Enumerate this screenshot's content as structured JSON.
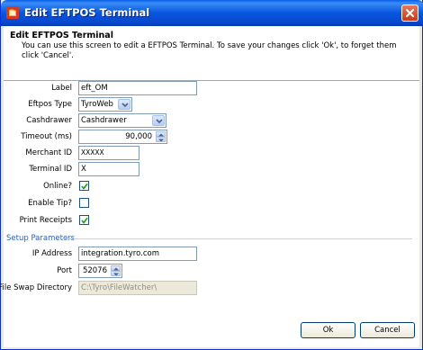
{
  "window": {
    "title": "Edit EFTPOS Terminal"
  },
  "header": {
    "title": "Edit EFTPOS Terminal",
    "description": "You can use this screen to edit a EFTPOS Terminal. To save your changes click 'Ok', to forget them click 'Cancel'."
  },
  "form": {
    "label": {
      "caption": "Label",
      "value": "eft_OM"
    },
    "eftpos_type": {
      "caption": "Eftpos Type",
      "value": "TyroWeb"
    },
    "cashdrawer": {
      "caption": "Cashdrawer",
      "value": "Cashdrawer"
    },
    "timeout": {
      "caption": "Timeout (ms)",
      "value": "90,000"
    },
    "merchant_id": {
      "caption": "Merchant ID",
      "value": "XXXXX"
    },
    "terminal_id": {
      "caption": "Terminal ID",
      "value": "X"
    },
    "online": {
      "caption": "Online?",
      "checked": true
    },
    "enable_tip": {
      "caption": "Enable Tip?",
      "checked": false
    },
    "print_receipts": {
      "caption": "Print Receipts",
      "checked": true
    }
  },
  "setup": {
    "section_title": "Setup Parameters",
    "ip_address": {
      "caption": "IP Address",
      "value": "integration.tyro.com"
    },
    "port": {
      "caption": "Port",
      "value": "52076"
    },
    "file_swap_directory": {
      "caption": "File Swap Directory",
      "value": "C:\\Tyro\\FileWatcher\\"
    }
  },
  "buttons": {
    "ok": "Ok",
    "cancel": "Cancel"
  },
  "colors": {
    "title_bar": "#0855dd",
    "section_header": "#2b5cb8",
    "close_button": "#c43a19"
  },
  "icons": {
    "app": "eftpos-app-icon",
    "close": "close-icon",
    "dropdown": "chevron-down-icon",
    "spinner": "spinner-arrows-icon",
    "check": "check-icon"
  }
}
